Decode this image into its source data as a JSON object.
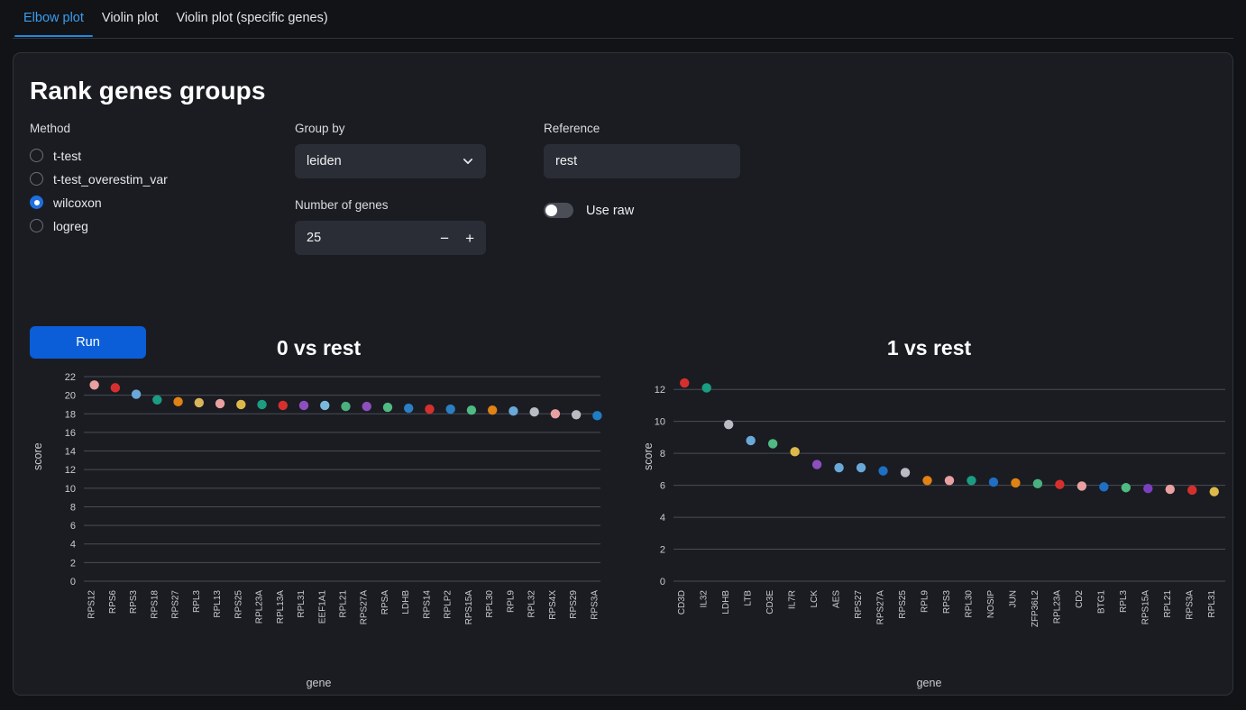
{
  "tabs": [
    {
      "label": "Elbow plot",
      "active": true
    },
    {
      "label": "Violin plot",
      "active": false
    },
    {
      "label": "Violin plot (specific genes)",
      "active": false
    }
  ],
  "card": {
    "title": "Rank genes groups"
  },
  "form": {
    "method": {
      "label": "Method",
      "options": [
        {
          "label": "t-test",
          "checked": false
        },
        {
          "label": "t-test_overestim_var",
          "checked": false
        },
        {
          "label": "wilcoxon",
          "checked": true
        },
        {
          "label": "logreg",
          "checked": false
        }
      ]
    },
    "group_by": {
      "label": "Group by",
      "value": "leiden",
      "icon": "chevron-down-icon"
    },
    "number_of_genes": {
      "label": "Number of genes",
      "value": "25",
      "decrement": "−",
      "increment": "+"
    },
    "reference": {
      "label": "Reference",
      "value": "rest",
      "placeholder": "rest"
    },
    "use_raw": {
      "label": "Use raw",
      "on": false
    },
    "run_label": "Run"
  },
  "accent": "#0b5ed7",
  "tab_accent": "#3b9dee",
  "chart_data": [
    {
      "type": "scatter",
      "title": "0 vs rest",
      "xlabel": "gene",
      "ylabel": "score",
      "ylim": [
        0,
        22
      ],
      "yticks": [
        0,
        2,
        4,
        6,
        8,
        10,
        12,
        14,
        16,
        18,
        20,
        22
      ],
      "grid": true,
      "categories": [
        "RPS12",
        "RPS6",
        "RPS3",
        "RPS18",
        "RPS27",
        "RPL3",
        "RPL13",
        "RPS25",
        "RPL23A",
        "RPL13A",
        "RPL31",
        "EEF1A1",
        "RPL21",
        "RPS27A",
        "RPSA",
        "LDHB",
        "RPS14",
        "RPLP2",
        "RPS15A",
        "RPL30",
        "RPL9",
        "RPL32",
        "RPS4X",
        "RPS29",
        "RPS3A"
      ],
      "values": [
        21.1,
        20.8,
        20.1,
        19.5,
        19.3,
        19.2,
        19.1,
        19.0,
        19.0,
        18.9,
        18.9,
        18.9,
        18.8,
        18.8,
        18.7,
        18.6,
        18.5,
        18.5,
        18.4,
        18.4,
        18.3,
        18.2,
        18.0,
        17.9,
        17.8
      ],
      "colors": [
        "#e8a0a0",
        "#d6302e",
        "#6aa8d8",
        "#1a9d82",
        "#e08214",
        "#d9b45b",
        "#e8a0a0",
        "#ddb94a",
        "#1a9d82",
        "#d6302e",
        "#8e4fbe",
        "#7ab8dd",
        "#49b07e",
        "#8e4fbe",
        "#4fba82",
        "#2b7fc4",
        "#d6302e",
        "#2b7fc4",
        "#4fba82",
        "#e08214",
        "#6aa8d8",
        "#b9bcc2",
        "#e8a0a0",
        "#b9bcc2",
        "#1f7ec4"
      ]
    },
    {
      "type": "scatter",
      "title": "1 vs rest",
      "xlabel": "gene",
      "ylabel": "score",
      "ylim": [
        0,
        12.8
      ],
      "yticks": [
        0,
        2,
        4,
        6,
        8,
        10,
        12
      ],
      "grid": true,
      "categories": [
        "CD3D",
        "IL32",
        "LDHB",
        "LTB",
        "CD3E",
        "IL7R",
        "LCK",
        "AES",
        "RPS27",
        "RPS27A",
        "RPS25",
        "RPL9",
        "RPS3",
        "RPL30",
        "NOSIP",
        "JUN",
        "ZFP36L2",
        "RPL23A",
        "CD2",
        "BTG1",
        "RPL3",
        "RPS15A",
        "RPL21",
        "RPS3A",
        "RPL31"
      ],
      "values": [
        12.4,
        12.1,
        9.8,
        8.8,
        8.6,
        8.1,
        7.3,
        7.1,
        7.1,
        6.9,
        6.8,
        6.3,
        6.3,
        6.3,
        6.2,
        6.15,
        6.1,
        6.05,
        5.95,
        5.9,
        5.85,
        5.8,
        5.75,
        5.7,
        5.6
      ],
      "colors": [
        "#d6302e",
        "#1a9d82",
        "#b9bcc2",
        "#6aa8d8",
        "#4fba82",
        "#ddb94a",
        "#8e4fbe",
        "#6aa8d8",
        "#6aa8d8",
        "#1f6fc4",
        "#b9bcc2",
        "#e08214",
        "#e8a0a0",
        "#1a9d82",
        "#1f6fc4",
        "#e08214",
        "#49b07e",
        "#d6302e",
        "#e8a0a0",
        "#1f6fc4",
        "#4fba82",
        "#7b3fbe",
        "#e8a0a0",
        "#d6302e",
        "#ddb94a"
      ]
    }
  ]
}
